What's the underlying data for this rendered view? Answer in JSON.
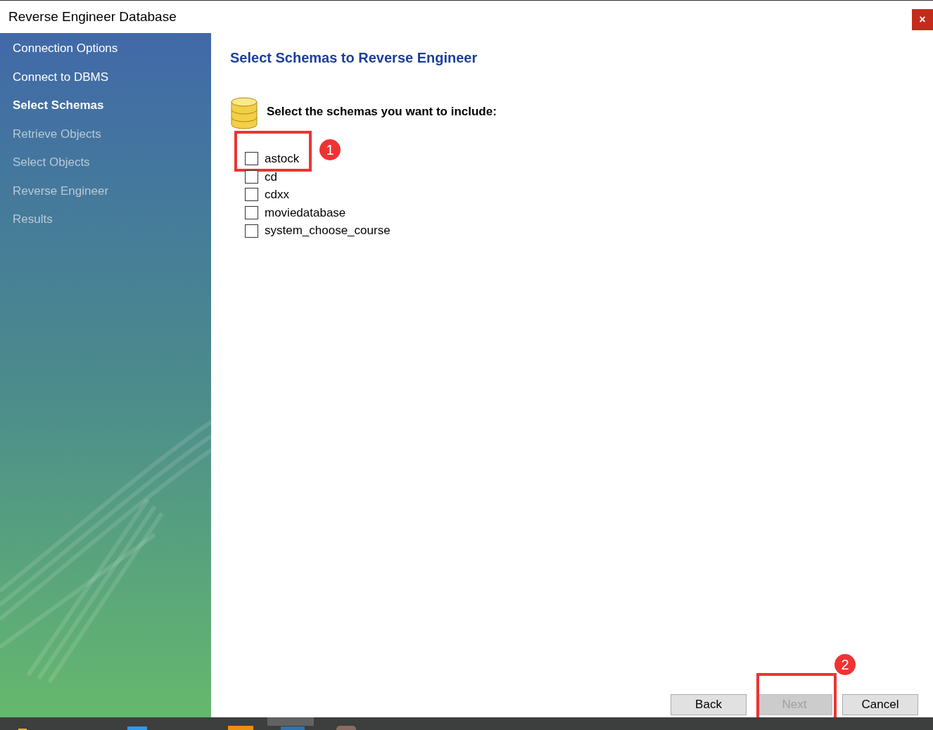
{
  "window": {
    "title": "Reverse Engineer Database",
    "close": "×"
  },
  "steps": [
    {
      "label": "Connection Options",
      "selected": false,
      "disabled": false
    },
    {
      "label": "Connect to DBMS",
      "selected": false,
      "disabled": false
    },
    {
      "label": "Select Schemas",
      "selected": true,
      "disabled": false
    },
    {
      "label": "Retrieve Objects",
      "selected": false,
      "disabled": true
    },
    {
      "label": "Select Objects",
      "selected": false,
      "disabled": true
    },
    {
      "label": "Reverse Engineer",
      "selected": false,
      "disabled": true
    },
    {
      "label": "Results",
      "selected": false,
      "disabled": true
    }
  ],
  "heading": "Select Schemas to Reverse Engineer",
  "prompt": "Select the schemas you want to include:",
  "schemas": [
    {
      "name": "astock",
      "checked": false,
      "callout": "1"
    },
    {
      "name": "cd",
      "checked": false
    },
    {
      "name": "cdxx",
      "checked": false
    },
    {
      "name": "moviedatabase",
      "checked": false
    },
    {
      "name": "system_choose_course",
      "checked": false
    }
  ],
  "buttons": [
    {
      "label": "Back",
      "disabled": false
    },
    {
      "label": "Next",
      "disabled": true,
      "callout": "2"
    },
    {
      "label": "Cancel",
      "disabled": false
    }
  ]
}
